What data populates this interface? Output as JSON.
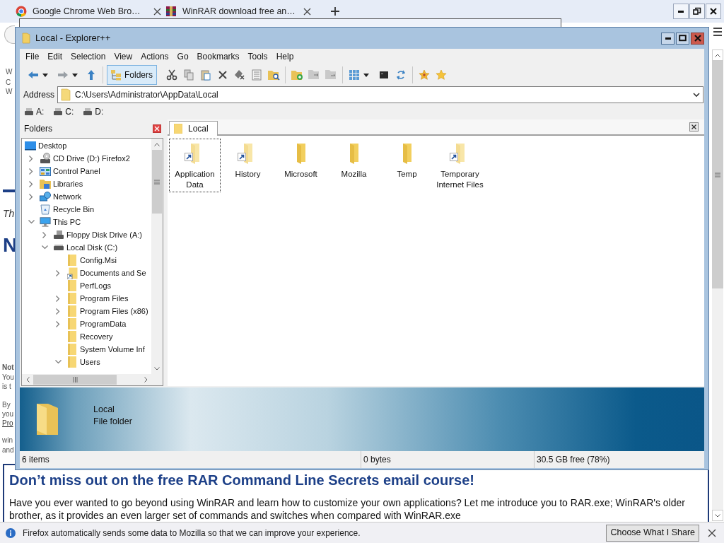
{
  "browser": {
    "tabs": [
      {
        "title": "Google Chrome Web Bro…"
      },
      {
        "title": "WinRAR download free an…"
      }
    ]
  },
  "background_page": {
    "fragments": [
      {
        "text": "W",
        "kind": "small"
      },
      {
        "text": "C",
        "kind": "small"
      },
      {
        "text": "W",
        "kind": "small"
      },
      {
        "text": "Th",
        "kind": "italic"
      },
      {
        "text": "N",
        "kind": "heading"
      },
      {
        "text": "Not",
        "kind": "bold"
      },
      {
        "text": "You",
        "kind": "small"
      },
      {
        "text": "is t",
        "kind": "small"
      },
      {
        "text": "By",
        "kind": "small"
      },
      {
        "text": "you",
        "kind": "small"
      },
      {
        "text": "Pro",
        "kind": "link"
      },
      {
        "text": "win",
        "kind": "small"
      },
      {
        "text": "and",
        "kind": "small"
      }
    ]
  },
  "explorer": {
    "title": "Local - Explorer++",
    "menu": [
      "File",
      "Edit",
      "Selection",
      "View",
      "Actions",
      "Go",
      "Bookmarks",
      "Tools",
      "Help"
    ],
    "toolbar": {
      "folders_button": {
        "label": "Folders",
        "pressed": true
      }
    },
    "address": {
      "label": "Address",
      "value": "C:\\Users\\Administrator\\AppData\\Local"
    },
    "drives": [
      "A:",
      "C:",
      "D:"
    ],
    "folders_pane": {
      "title": "Folders",
      "tree": [
        {
          "label": "Desktop",
          "kind": "desktop",
          "children": [
            {
              "label": "CD Drive (D:) Firefox2",
              "kind": "cd-drive",
              "expanded": false
            },
            {
              "label": "Control Panel",
              "kind": "control-panel",
              "expanded": false
            },
            {
              "label": "Libraries",
              "kind": "libraries",
              "expanded": false
            },
            {
              "label": "Network",
              "kind": "network",
              "expanded": false
            },
            {
              "label": "Recycle Bin",
              "kind": "recycle-bin"
            },
            {
              "label": "This PC",
              "kind": "pc",
              "expanded": true,
              "children": [
                {
                  "label": "Floppy Disk Drive (A:)",
                  "kind": "floppy",
                  "expanded": false
                },
                {
                  "label": "Local Disk (C:)",
                  "kind": "disk",
                  "expanded": true,
                  "children": [
                    {
                      "label": "Config.Msi",
                      "kind": "folder"
                    },
                    {
                      "label": "Documents and Se",
                      "kind": "folder-shortcut",
                      "expanded": false
                    },
                    {
                      "label": "PerfLogs",
                      "kind": "folder"
                    },
                    {
                      "label": "Program Files",
                      "kind": "folder",
                      "expanded": false
                    },
                    {
                      "label": "Program Files (x86)",
                      "kind": "folder",
                      "expanded": false
                    },
                    {
                      "label": "ProgramData",
                      "kind": "folder",
                      "expanded": false
                    },
                    {
                      "label": "Recovery",
                      "kind": "folder"
                    },
                    {
                      "label": "System Volume Inf",
                      "kind": "folder"
                    },
                    {
                      "label": "Users",
                      "kind": "folder",
                      "expanded": true
                    }
                  ]
                }
              ]
            }
          ]
        }
      ]
    },
    "tabs": [
      {
        "label": "Local",
        "selected": true
      }
    ],
    "items": [
      {
        "label": "Application Data",
        "shortcut": true,
        "selected": true
      },
      {
        "label": "History",
        "shortcut": true,
        "selected": false
      },
      {
        "label": "Microsoft",
        "shortcut": false,
        "selected": false
      },
      {
        "label": "Mozilla",
        "shortcut": false,
        "selected": false
      },
      {
        "label": "Temp",
        "shortcut": false,
        "selected": false
      },
      {
        "label": "Temporary Internet Files",
        "shortcut": true,
        "selected": false
      }
    ],
    "info_pane": {
      "name": "Local",
      "type": "File folder"
    },
    "status_bar": [
      "6 items",
      "0 bytes",
      "30.5 GB free (78%)"
    ]
  },
  "article": {
    "heading": "Don’t miss out on the free RAR Command Line Secrets email course!",
    "paragraph": "Have you ever wanted to go beyond using WinRAR and learn how to customize your own applications? Let me introduce you to RAR.exe; WinRAR's older brother, as it provides an even larger set of commands and switches when compared with WinRAR.exe"
  },
  "notification": {
    "message": "Firefox automatically sends some data to Mozilla so that we can improve your experience.",
    "button": "Choose What I Share"
  }
}
